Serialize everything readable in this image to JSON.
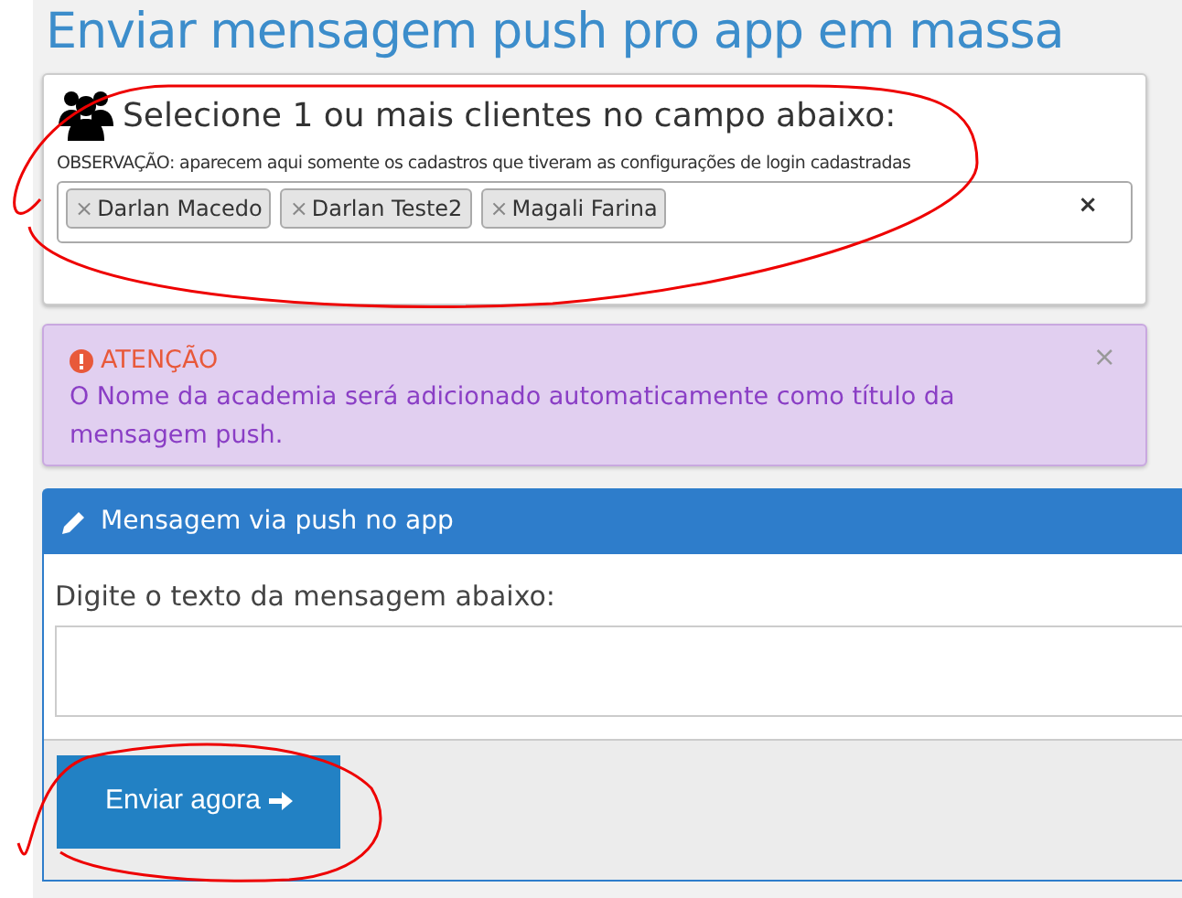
{
  "page_title": "Enviar mensagem push pro app em massa",
  "clients_card": {
    "heading": "Selecione 1 ou mais clientes no campo abaixo:",
    "note": "OBSERVAÇÃO: aparecem aqui somente os cadastros que tiveram as configurações de login cadastradas",
    "tags": [
      {
        "remove": "×",
        "label": "Darlan Macedo"
      },
      {
        "remove": "×",
        "label": "Darlan Teste2"
      },
      {
        "remove": "×",
        "label": "Magali Farina"
      }
    ],
    "clear": "×"
  },
  "alert": {
    "title": "ATENÇÃO",
    "message": "O Nome da academia será adicionado automaticamente como título da mensagem push.",
    "close": "×"
  },
  "message_panel": {
    "header": "Mensagem via push no app",
    "label": "Digite o texto da mensagem abaixo:",
    "button": "Enviar agora"
  }
}
